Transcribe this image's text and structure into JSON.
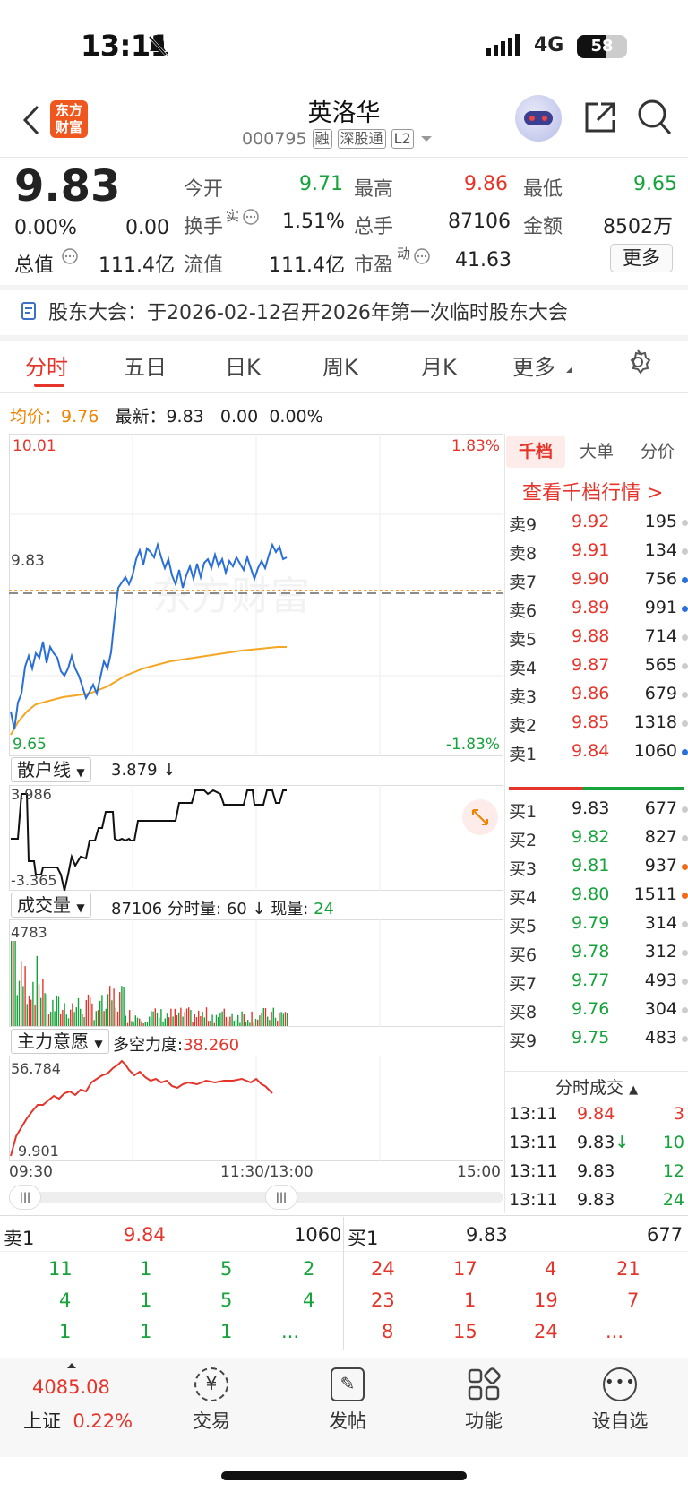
{
  "status_bar": {
    "time": "13:11",
    "network": "4G",
    "battery": "58"
  },
  "header": {
    "app_logo_line1": "东方",
    "app_logo_line2": "财富",
    "stock_name": "英洛华",
    "stock_code": "000795",
    "tags": [
      "融",
      "深股通",
      "L2"
    ]
  },
  "quote": {
    "price": "9.83",
    "change_pct": "0.00%",
    "change": "0.00",
    "open_label": "今开",
    "open": "9.71",
    "high_label": "最高",
    "high": "9.86",
    "low_label": "最低",
    "low": "9.65",
    "turnover_label": "换手",
    "turnover_sup": "实",
    "turnover": "1.51%",
    "volume_label": "总手",
    "volume": "87106",
    "amount_label": "金额",
    "amount": "8502万",
    "total_mv_label": "总值",
    "total_mv": "111.4亿",
    "float_mv_label": "流值",
    "float_mv": "111.4亿",
    "pe_label": "市盈",
    "pe_sup": "动",
    "pe": "41.63",
    "more_label": "更多"
  },
  "notice": {
    "text": "股东大会：于2026-02-12召开2026年第一次临时股东大会"
  },
  "tabs": [
    "分时",
    "五日",
    "日K",
    "周K",
    "月K",
    "更多"
  ],
  "active_tab": "分时",
  "avg_line": {
    "avg_label": "均价：",
    "avg": "9.76",
    "latest_label": "最新：",
    "latest": "9.83",
    "chg": "0.00",
    "chg_pct": "0.00%"
  },
  "intraday": {
    "y_top": "10.01",
    "y_mid": "9.83",
    "y_bottom": "9.65",
    "pct_top": "1.83%",
    "pct_bottom": "-1.83%",
    "watermark": "东方财富",
    "x_labels": [
      "09:30",
      "11:30/13:00",
      "15:00"
    ]
  },
  "retail": {
    "dropdown": "散户线",
    "value": "3.879 ↓",
    "y_top": "3.986",
    "y_bottom": "-3.365"
  },
  "volume_panel": {
    "dropdown": "成交量",
    "total": "87106",
    "minute_label": "分时量:",
    "minute_value": "60 ↓",
    "now_label": "现量:",
    "now_value": "24",
    "y_top": "4783"
  },
  "main_force": {
    "dropdown": "主力意愿",
    "label": "多空力度:",
    "value": "38.260",
    "y_top": "56.784",
    "y_bottom": "9.901"
  },
  "side_tabs": [
    "千档",
    "大单",
    "分价"
  ],
  "qiandang_link": "查看千档行情 >",
  "asks": [
    {
      "label": "卖9",
      "price": "9.92",
      "vol": "195",
      "dot": "#cccccc"
    },
    {
      "label": "卖8",
      "price": "9.91",
      "vol": "134",
      "dot": "#cccccc"
    },
    {
      "label": "卖7",
      "price": "9.90",
      "vol": "756",
      "dot": "#2a6fd6"
    },
    {
      "label": "卖6",
      "price": "9.89",
      "vol": "991",
      "dot": "#2a6fd6"
    },
    {
      "label": "卖5",
      "price": "9.88",
      "vol": "714",
      "dot": "#cccccc"
    },
    {
      "label": "卖4",
      "price": "9.87",
      "vol": "565",
      "dot": "#cccccc"
    },
    {
      "label": "卖3",
      "price": "9.86",
      "vol": "679",
      "dot": "#cccccc"
    },
    {
      "label": "卖2",
      "price": "9.85",
      "vol": "1318",
      "dot": "#cccccc"
    },
    {
      "label": "卖1",
      "price": "9.84",
      "vol": "1060",
      "dot": "#2a6fd6"
    }
  ],
  "bids": [
    {
      "label": "买1",
      "price": "9.83",
      "vol": "677",
      "dot": "#cccccc"
    },
    {
      "label": "买2",
      "price": "9.82",
      "vol": "827",
      "dot": "#cccccc"
    },
    {
      "label": "买3",
      "price": "9.81",
      "vol": "937",
      "dot": "#f06a1d"
    },
    {
      "label": "买4",
      "price": "9.80",
      "vol": "1511",
      "dot": "#f06a1d"
    },
    {
      "label": "买5",
      "price": "9.79",
      "vol": "314",
      "dot": "#cccccc"
    },
    {
      "label": "买6",
      "price": "9.78",
      "vol": "312",
      "dot": "#cccccc"
    },
    {
      "label": "买7",
      "price": "9.77",
      "vol": "493",
      "dot": "#cccccc"
    },
    {
      "label": "买8",
      "price": "9.76",
      "vol": "304",
      "dot": "#cccccc"
    },
    {
      "label": "买9",
      "price": "9.75",
      "vol": "483",
      "dot": "#cccccc"
    }
  ],
  "trades_title": "分时成交",
  "trades": [
    {
      "time": "13:11",
      "price": "9.84",
      "arrow": "",
      "vol": "3",
      "pcolor": "red",
      "vcolor": "red"
    },
    {
      "time": "13:11",
      "price": "9.83",
      "arrow": "↓",
      "vol": "10",
      "pcolor": "dark",
      "vcolor": "green"
    },
    {
      "time": "13:11",
      "price": "9.83",
      "arrow": "",
      "vol": "12",
      "pcolor": "dark",
      "vcolor": "green"
    },
    {
      "time": "13:11",
      "price": "9.83",
      "arrow": "",
      "vol": "24",
      "pcolor": "dark",
      "vcolor": "green"
    }
  ],
  "level2": {
    "sell1_label": "卖1",
    "sell1_price": "9.84",
    "sell1_vol": "1060",
    "buy1_label": "买1",
    "buy1_price": "9.83",
    "buy1_vol": "677",
    "sell_queue": [
      [
        "11",
        "1",
        "5",
        "2"
      ],
      [
        "4",
        "1",
        "5",
        "4"
      ],
      [
        "1",
        "1",
        "1",
        "..."
      ]
    ],
    "buy_queue": [
      [
        "24",
        "17",
        "4",
        "21"
      ],
      [
        "23",
        "1",
        "19",
        "7"
      ],
      [
        "8",
        "15",
        "24",
        "..."
      ]
    ]
  },
  "index": {
    "value": "4085.08",
    "name": "上证",
    "pct": "0.22%"
  },
  "tabbar": [
    "交易",
    "发帖",
    "功能",
    "设自选"
  ]
}
